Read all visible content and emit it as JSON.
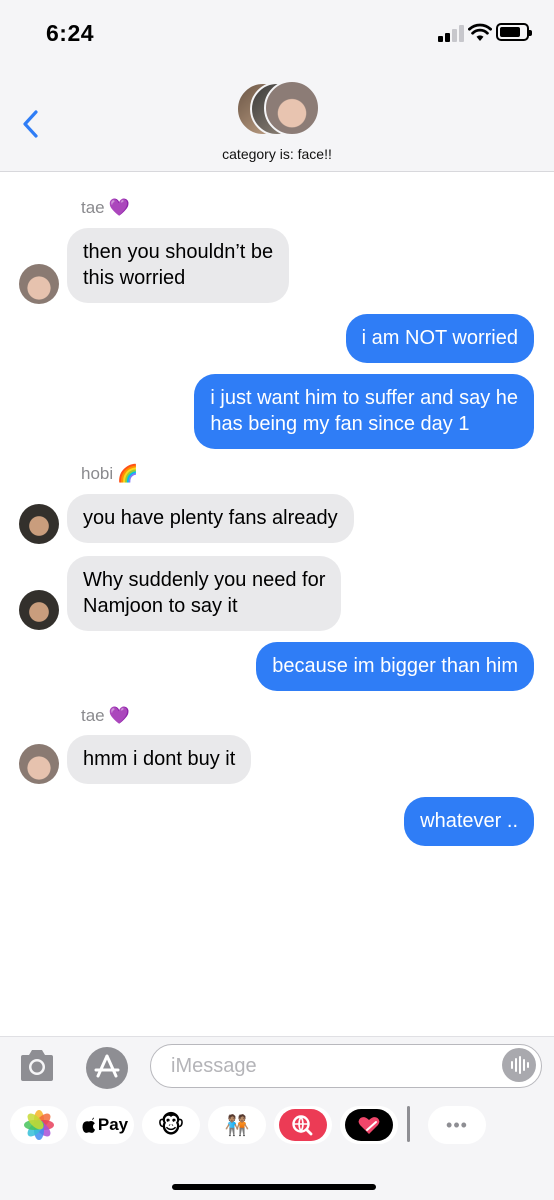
{
  "status_bar": {
    "time": "6:24"
  },
  "conversation": {
    "title": "category is: face!!"
  },
  "messages": [
    {
      "type": "sender",
      "name": "tae",
      "emoji": "💜"
    },
    {
      "type": "in",
      "text": "then you shouldn’t be\nthis worried"
    },
    {
      "type": "out",
      "text": "i am NOT worried"
    },
    {
      "type": "out",
      "text": "i just want him to suffer and say he\nhas being my fan since day 1"
    },
    {
      "type": "sender",
      "name": "hobi",
      "emoji": "🌈"
    },
    {
      "type": "in",
      "text": "you have plenty fans already"
    },
    {
      "type": "in",
      "text": " Why suddenly you need for\nNamjoon to say it"
    },
    {
      "type": "out",
      "text": "because im bigger than him"
    },
    {
      "type": "sender",
      "name": "tae",
      "emoji": "💜"
    },
    {
      "type": "in",
      "text": "hmm i dont buy it"
    },
    {
      "type": "out",
      "text": "whatever .."
    }
  ],
  "compose": {
    "placeholder": "iMessage"
  },
  "apps": {
    "applepay_label": "Pay",
    "animoji": "🐵",
    "memoji": "🧑🏽‍🤝‍🧑🏽",
    "more": "•••"
  },
  "colors": {
    "outgoing": "#2f7df6",
    "incoming": "#e9e9eb",
    "sender_name": "#8a8a8e"
  }
}
